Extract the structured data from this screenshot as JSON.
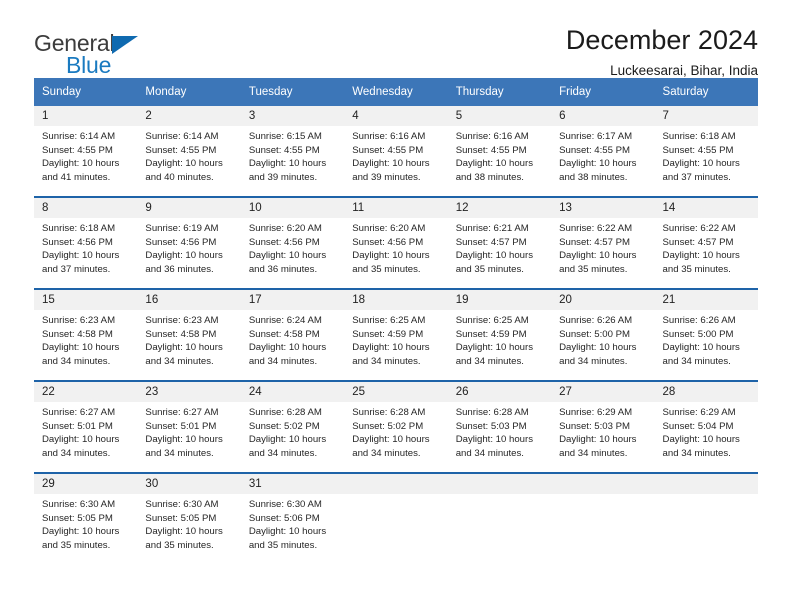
{
  "brand": {
    "name_part1": "General",
    "name_part2": "Blue",
    "accent_color": "#1a7ac0",
    "triangle_color": "#0f6ab0"
  },
  "header": {
    "title": "December 2024",
    "subtitle": "Luckeesarai, Bihar, India"
  },
  "calendar": {
    "header_bg": "#3c76b8",
    "header_text_color": "#ffffff",
    "daynum_bg": "#f1f1f1",
    "separator_color": "#1e63a8",
    "weekday_headers": [
      "Sunday",
      "Monday",
      "Tuesday",
      "Wednesday",
      "Thursday",
      "Friday",
      "Saturday"
    ],
    "weeks": [
      [
        {
          "day": "1",
          "sunrise": "Sunrise: 6:14 AM",
          "sunset": "Sunset: 4:55 PM",
          "daylight_1": "Daylight: 10 hours",
          "daylight_2": "and 41 minutes."
        },
        {
          "day": "2",
          "sunrise": "Sunrise: 6:14 AM",
          "sunset": "Sunset: 4:55 PM",
          "daylight_1": "Daylight: 10 hours",
          "daylight_2": "and 40 minutes."
        },
        {
          "day": "3",
          "sunrise": "Sunrise: 6:15 AM",
          "sunset": "Sunset: 4:55 PM",
          "daylight_1": "Daylight: 10 hours",
          "daylight_2": "and 39 minutes."
        },
        {
          "day": "4",
          "sunrise": "Sunrise: 6:16 AM",
          "sunset": "Sunset: 4:55 PM",
          "daylight_1": "Daylight: 10 hours",
          "daylight_2": "and 39 minutes."
        },
        {
          "day": "5",
          "sunrise": "Sunrise: 6:16 AM",
          "sunset": "Sunset: 4:55 PM",
          "daylight_1": "Daylight: 10 hours",
          "daylight_2": "and 38 minutes."
        },
        {
          "day": "6",
          "sunrise": "Sunrise: 6:17 AM",
          "sunset": "Sunset: 4:55 PM",
          "daylight_1": "Daylight: 10 hours",
          "daylight_2": "and 38 minutes."
        },
        {
          "day": "7",
          "sunrise": "Sunrise: 6:18 AM",
          "sunset": "Sunset: 4:55 PM",
          "daylight_1": "Daylight: 10 hours",
          "daylight_2": "and 37 minutes."
        }
      ],
      [
        {
          "day": "8",
          "sunrise": "Sunrise: 6:18 AM",
          "sunset": "Sunset: 4:56 PM",
          "daylight_1": "Daylight: 10 hours",
          "daylight_2": "and 37 minutes."
        },
        {
          "day": "9",
          "sunrise": "Sunrise: 6:19 AM",
          "sunset": "Sunset: 4:56 PM",
          "daylight_1": "Daylight: 10 hours",
          "daylight_2": "and 36 minutes."
        },
        {
          "day": "10",
          "sunrise": "Sunrise: 6:20 AM",
          "sunset": "Sunset: 4:56 PM",
          "daylight_1": "Daylight: 10 hours",
          "daylight_2": "and 36 minutes."
        },
        {
          "day": "11",
          "sunrise": "Sunrise: 6:20 AM",
          "sunset": "Sunset: 4:56 PM",
          "daylight_1": "Daylight: 10 hours",
          "daylight_2": "and 35 minutes."
        },
        {
          "day": "12",
          "sunrise": "Sunrise: 6:21 AM",
          "sunset": "Sunset: 4:57 PM",
          "daylight_1": "Daylight: 10 hours",
          "daylight_2": "and 35 minutes."
        },
        {
          "day": "13",
          "sunrise": "Sunrise: 6:22 AM",
          "sunset": "Sunset: 4:57 PM",
          "daylight_1": "Daylight: 10 hours",
          "daylight_2": "and 35 minutes."
        },
        {
          "day": "14",
          "sunrise": "Sunrise: 6:22 AM",
          "sunset": "Sunset: 4:57 PM",
          "daylight_1": "Daylight: 10 hours",
          "daylight_2": "and 35 minutes."
        }
      ],
      [
        {
          "day": "15",
          "sunrise": "Sunrise: 6:23 AM",
          "sunset": "Sunset: 4:58 PM",
          "daylight_1": "Daylight: 10 hours",
          "daylight_2": "and 34 minutes."
        },
        {
          "day": "16",
          "sunrise": "Sunrise: 6:23 AM",
          "sunset": "Sunset: 4:58 PM",
          "daylight_1": "Daylight: 10 hours",
          "daylight_2": "and 34 minutes."
        },
        {
          "day": "17",
          "sunrise": "Sunrise: 6:24 AM",
          "sunset": "Sunset: 4:58 PM",
          "daylight_1": "Daylight: 10 hours",
          "daylight_2": "and 34 minutes."
        },
        {
          "day": "18",
          "sunrise": "Sunrise: 6:25 AM",
          "sunset": "Sunset: 4:59 PM",
          "daylight_1": "Daylight: 10 hours",
          "daylight_2": "and 34 minutes."
        },
        {
          "day": "19",
          "sunrise": "Sunrise: 6:25 AM",
          "sunset": "Sunset: 4:59 PM",
          "daylight_1": "Daylight: 10 hours",
          "daylight_2": "and 34 minutes."
        },
        {
          "day": "20",
          "sunrise": "Sunrise: 6:26 AM",
          "sunset": "Sunset: 5:00 PM",
          "daylight_1": "Daylight: 10 hours",
          "daylight_2": "and 34 minutes."
        },
        {
          "day": "21",
          "sunrise": "Sunrise: 6:26 AM",
          "sunset": "Sunset: 5:00 PM",
          "daylight_1": "Daylight: 10 hours",
          "daylight_2": "and 34 minutes."
        }
      ],
      [
        {
          "day": "22",
          "sunrise": "Sunrise: 6:27 AM",
          "sunset": "Sunset: 5:01 PM",
          "daylight_1": "Daylight: 10 hours",
          "daylight_2": "and 34 minutes."
        },
        {
          "day": "23",
          "sunrise": "Sunrise: 6:27 AM",
          "sunset": "Sunset: 5:01 PM",
          "daylight_1": "Daylight: 10 hours",
          "daylight_2": "and 34 minutes."
        },
        {
          "day": "24",
          "sunrise": "Sunrise: 6:28 AM",
          "sunset": "Sunset: 5:02 PM",
          "daylight_1": "Daylight: 10 hours",
          "daylight_2": "and 34 minutes."
        },
        {
          "day": "25",
          "sunrise": "Sunrise: 6:28 AM",
          "sunset": "Sunset: 5:02 PM",
          "daylight_1": "Daylight: 10 hours",
          "daylight_2": "and 34 minutes."
        },
        {
          "day": "26",
          "sunrise": "Sunrise: 6:28 AM",
          "sunset": "Sunset: 5:03 PM",
          "daylight_1": "Daylight: 10 hours",
          "daylight_2": "and 34 minutes."
        },
        {
          "day": "27",
          "sunrise": "Sunrise: 6:29 AM",
          "sunset": "Sunset: 5:03 PM",
          "daylight_1": "Daylight: 10 hours",
          "daylight_2": "and 34 minutes."
        },
        {
          "day": "28",
          "sunrise": "Sunrise: 6:29 AM",
          "sunset": "Sunset: 5:04 PM",
          "daylight_1": "Daylight: 10 hours",
          "daylight_2": "and 34 minutes."
        }
      ],
      [
        {
          "day": "29",
          "sunrise": "Sunrise: 6:30 AM",
          "sunset": "Sunset: 5:05 PM",
          "daylight_1": "Daylight: 10 hours",
          "daylight_2": "and 35 minutes."
        },
        {
          "day": "30",
          "sunrise": "Sunrise: 6:30 AM",
          "sunset": "Sunset: 5:05 PM",
          "daylight_1": "Daylight: 10 hours",
          "daylight_2": "and 35 minutes."
        },
        {
          "day": "31",
          "sunrise": "Sunrise: 6:30 AM",
          "sunset": "Sunset: 5:06 PM",
          "daylight_1": "Daylight: 10 hours",
          "daylight_2": "and 35 minutes."
        },
        {
          "day": "",
          "sunrise": "",
          "sunset": "",
          "daylight_1": "",
          "daylight_2": ""
        },
        {
          "day": "",
          "sunrise": "",
          "sunset": "",
          "daylight_1": "",
          "daylight_2": ""
        },
        {
          "day": "",
          "sunrise": "",
          "sunset": "",
          "daylight_1": "",
          "daylight_2": ""
        },
        {
          "day": "",
          "sunrise": "",
          "sunset": "",
          "daylight_1": "",
          "daylight_2": ""
        }
      ]
    ]
  }
}
